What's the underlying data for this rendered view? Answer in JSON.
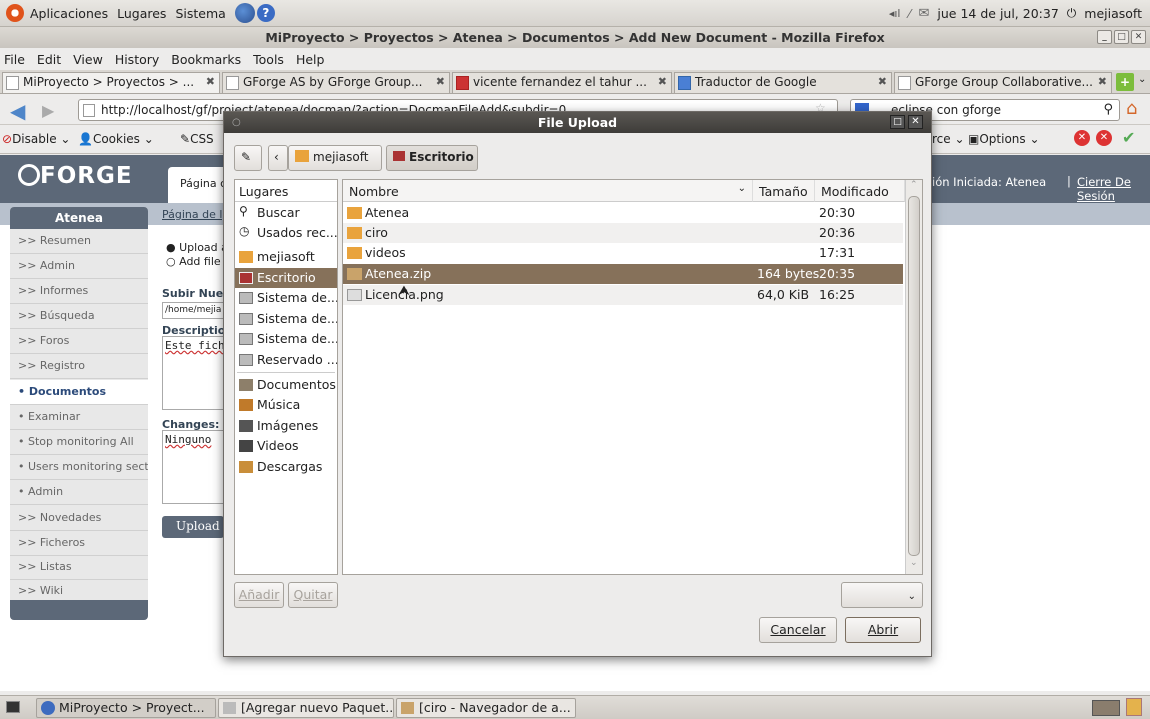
{
  "top_panel": {
    "menus": [
      "Aplicaciones",
      "Lugares",
      "Sistema"
    ],
    "datetime": "jue 14 de jul, 20:37",
    "user": "mejiasoft"
  },
  "window": {
    "title": "MiProyecto > Proyectos > Atenea > Documentos > Add New Document - Mozilla Firefox"
  },
  "menubar": [
    "File",
    "Edit",
    "View",
    "History",
    "Bookmarks",
    "Tools",
    "Help"
  ],
  "tabs": [
    {
      "label": "MiProyecto > Proyectos > ..."
    },
    {
      "label": "GForge AS by GForge Group..."
    },
    {
      "label": "vicente fernandez el tahur ..."
    },
    {
      "label": "Traductor de Google"
    },
    {
      "label": "GForge Group Collaborative..."
    }
  ],
  "navbar": {
    "url": "http://localhost/gf/project/atenea/docman/?action=DocmanFileAdd&subdir=0",
    "search": "eclipse con gforge"
  },
  "webdev": {
    "disable": "Disable",
    "cookies": "Cookies",
    "css": "CSS",
    "source_partial": "rce",
    "options": "Options"
  },
  "gforge": {
    "logo": "FORGE",
    "nav_partial": "Página c",
    "session": "ión Iniciada: Atenea",
    "logout": "Cierre De Sesión",
    "breadcrumb_partial": "Página de l",
    "sidebar_title": "Atenea",
    "sidebar_items": [
      ">> Resumen",
      ">> Admin",
      ">> Informes",
      ">> Búsqueda",
      ">> Foros",
      ">> Registro",
      "Documentos",
      "Examinar",
      "Stop monitoring All",
      "Users monitoring sect",
      "Admin",
      ">> Novedades",
      ">> Ficheros",
      ">> Listas",
      ">> Wiki"
    ],
    "upload_a": "Upload a",
    "add_file": "Add file v",
    "subir": "Subir Nuev",
    "path": "/home/mejia",
    "description": "Description",
    "desc_text": "Este fiche",
    "changes": "Changes:",
    "changes_text": "Ninguno",
    "upload_button": "Upload"
  },
  "dialog": {
    "title": "File Upload",
    "crumbs": [
      "mejiasoft",
      "Escritorio"
    ],
    "places_header": "Lugares",
    "places": [
      "Buscar",
      "Usados rec...",
      "mejiasoft",
      "Escritorio",
      "Sistema de...",
      "Sistema de...",
      "Sistema de...",
      "Reservado ...",
      "Documentos",
      "Música",
      "Imágenes",
      "Videos",
      "Descargas"
    ],
    "columns": {
      "name": "Nombre",
      "size": "Tamaño",
      "modified": "Modificado"
    },
    "files": [
      {
        "name": "Atenea",
        "size": "",
        "modified": "20:30"
      },
      {
        "name": "ciro",
        "size": "",
        "modified": "20:36"
      },
      {
        "name": "videos",
        "size": "",
        "modified": "17:31"
      },
      {
        "name": "Atenea.zip",
        "size": "164 bytes",
        "modified": "20:35"
      },
      {
        "name": "Licencia.png",
        "size": "64,0 KiB",
        "modified": "16:25"
      }
    ],
    "add_button": "Añadir",
    "remove_button": "Quitar",
    "cancel_button": "Cancelar",
    "open_button": "Abrir"
  },
  "taskbar": [
    "MiProyecto > Proyect...",
    "[Agregar nuevo Paquet...",
    "[ciro - Navegador de a..."
  ]
}
